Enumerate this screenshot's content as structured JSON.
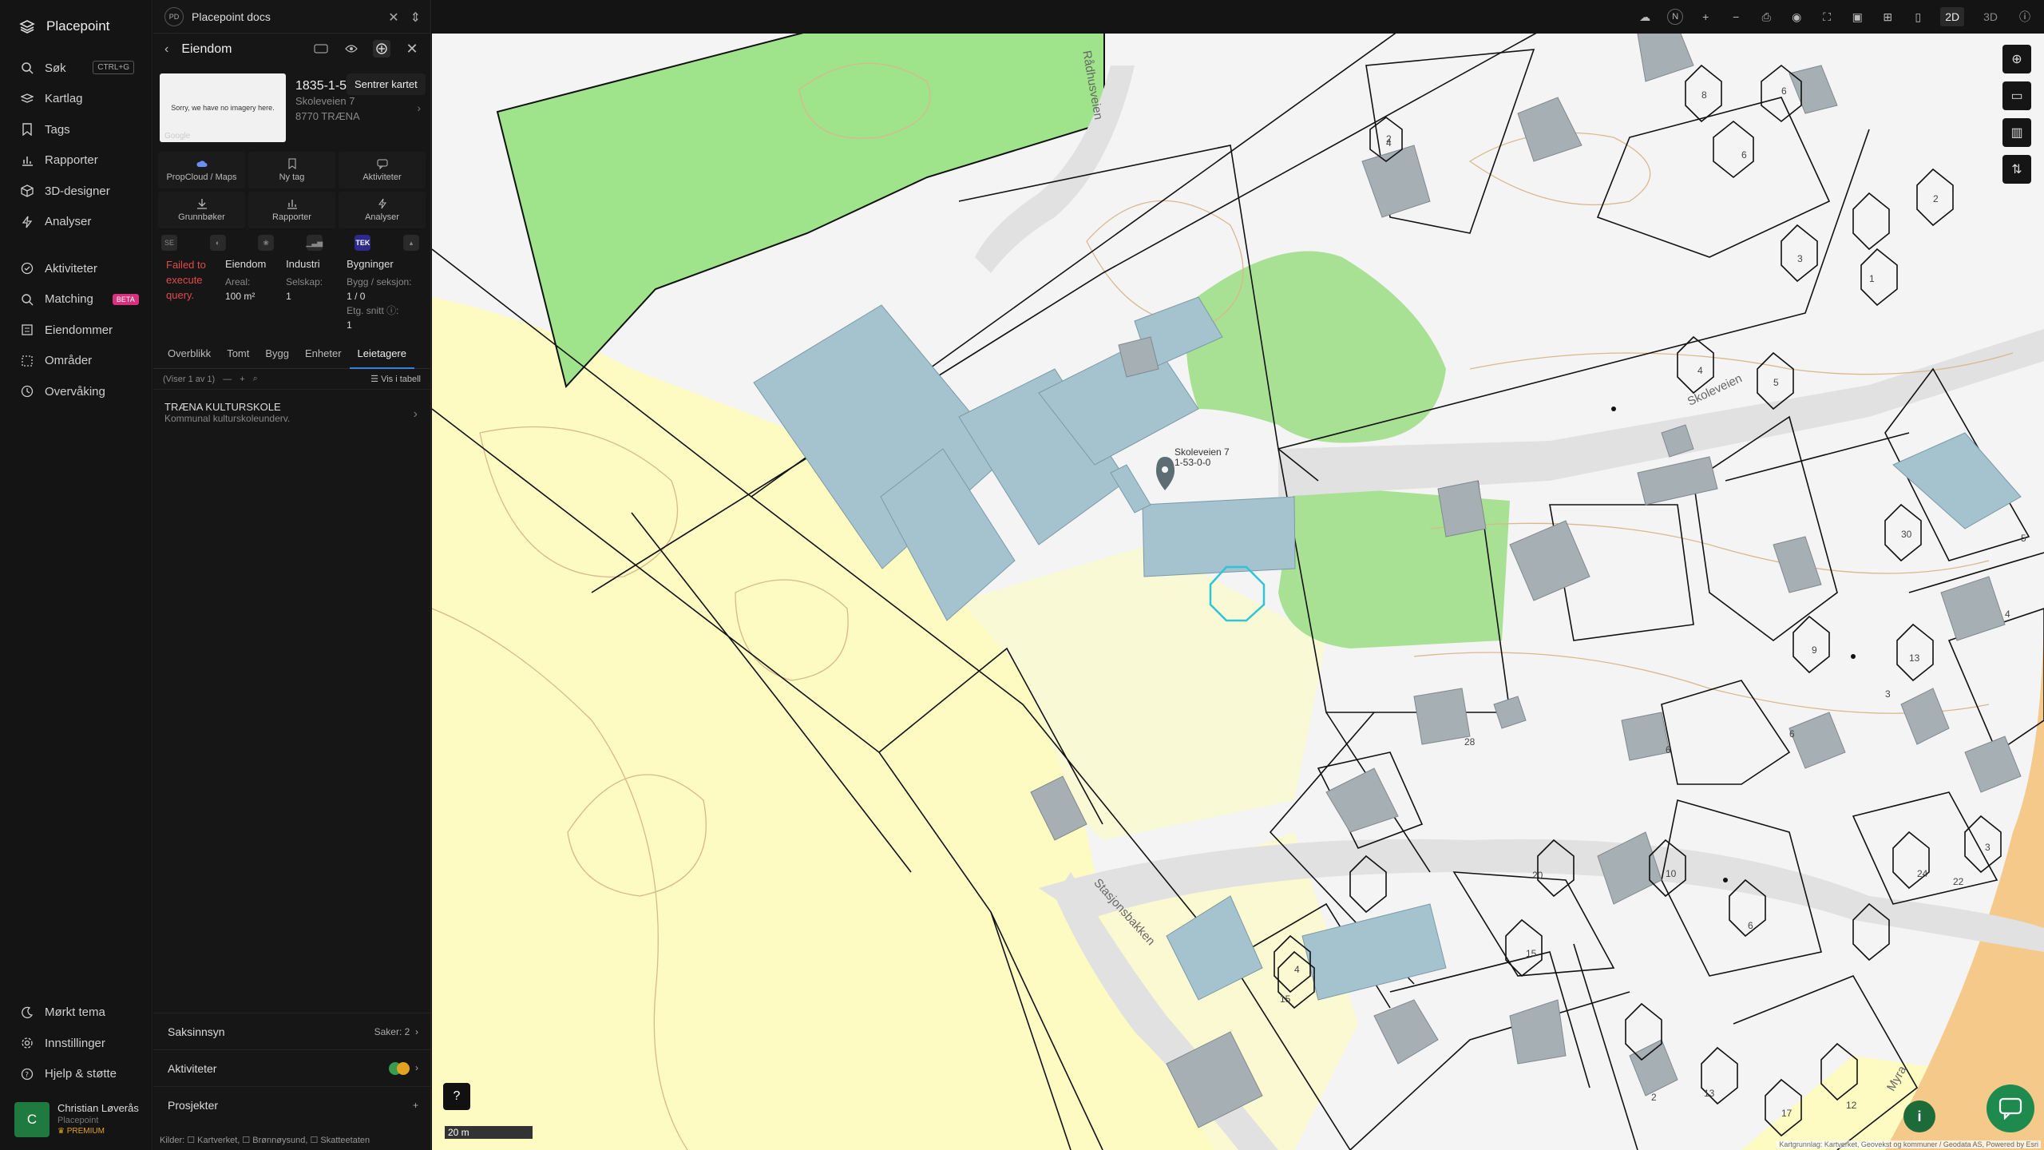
{
  "app": {
    "name": "Placepoint"
  },
  "nav": {
    "items": [
      {
        "label": "Søk",
        "kbd": "CTRL+G"
      },
      {
        "label": "Kartlag"
      },
      {
        "label": "Tags"
      },
      {
        "label": "Rapporter"
      },
      {
        "label": "3D-designer"
      },
      {
        "label": "Analyser"
      }
    ],
    "items2": [
      {
        "label": "Aktiviteter"
      },
      {
        "label": "Matching",
        "badge": "BETA"
      },
      {
        "label": "Eiendommer"
      },
      {
        "label": "Områder"
      },
      {
        "label": "Overvåking"
      }
    ],
    "bottom": [
      {
        "label": "Mørkt tema"
      },
      {
        "label": "Innstillinger"
      },
      {
        "label": "Hjelp & støtte"
      }
    ],
    "user": {
      "initial": "C",
      "name": "Christian Løverås",
      "org": "Placepoint",
      "plan": "PREMIUM"
    }
  },
  "panel": {
    "doc": {
      "initials": "PD",
      "title": "Placepoint docs"
    },
    "title": "Eiendom",
    "tooltip": "Sentrer kartet",
    "thumb_text": "Sorry, we have no imagery here.",
    "thumb_brand": "Google",
    "property": {
      "id": "1835-1-53-0-0",
      "address": "Skoleveien 7",
      "postal": "8770 TRÆNA"
    },
    "actions": [
      "PropCloud / Maps",
      "Ny tag",
      "Aktiviteter",
      "Grunnbøker",
      "Rapporter",
      "Analyser"
    ],
    "tek": "TEK",
    "error": "Failed to execute query.",
    "stats": [
      {
        "title": "Eiendom",
        "label": "Areal:",
        "value": "100 m²"
      },
      {
        "title": "Industri",
        "label": "Selskap:",
        "value": "1"
      },
      {
        "title": "Bygninger",
        "label": "Bygg / seksjon:",
        "value": "1 / 0",
        "label2": "Etg. snitt ⓘ:",
        "value2": "1"
      }
    ],
    "tabs": [
      "Overblikk",
      "Tomt",
      "Bygg",
      "Enheter",
      "Leietagere"
    ],
    "filter": {
      "showing": "(Viser 1 av 1)",
      "table_link": "Vis i tabell"
    },
    "lessee": {
      "name": "TRÆNA KULTURSKOLE",
      "desc": "Kommunal kulturskoleunderv."
    },
    "sections": [
      {
        "label": "Saksinnsyn",
        "right": "Saker: 2"
      },
      {
        "label": "Aktiviteter"
      },
      {
        "label": "Prosjekter"
      }
    ],
    "sources": "Kilder: ☐ Kartverket, ☐ Brønnøysund, ☐ Skatteetaten"
  },
  "topbar": {
    "north": "N",
    "view2d": "2D",
    "view3d": "3D"
  },
  "map": {
    "roads": [
      "Rådhusveien",
      "Skoleveien",
      "Stasjonsbakken",
      "Myra"
    ],
    "marker": {
      "address": "Skoleveien 7",
      "id": "1-53-0-0"
    },
    "scale": "20 m",
    "attribution": "Kartgrunnlag: Kartverket, Geovekst og kommuner / Geodata AS, Powered by Esri",
    "numbers": [
      "2",
      "8",
      "6",
      "4",
      "6",
      "3",
      "1",
      "2",
      "4",
      "5",
      "5",
      "30",
      "4",
      "6",
      "28",
      "9",
      "13",
      "3",
      "24",
      "22",
      "20",
      "10",
      "6",
      "4",
      "15",
      "15",
      "13",
      "2",
      "12",
      "17",
      "6",
      "3"
    ]
  },
  "colors": {
    "green": "#9fe38b",
    "yellow": "#fdfbc2",
    "building": "#a4c3cf",
    "grey_building": "#a6b0b4",
    "accent": "#3b7fd9"
  }
}
